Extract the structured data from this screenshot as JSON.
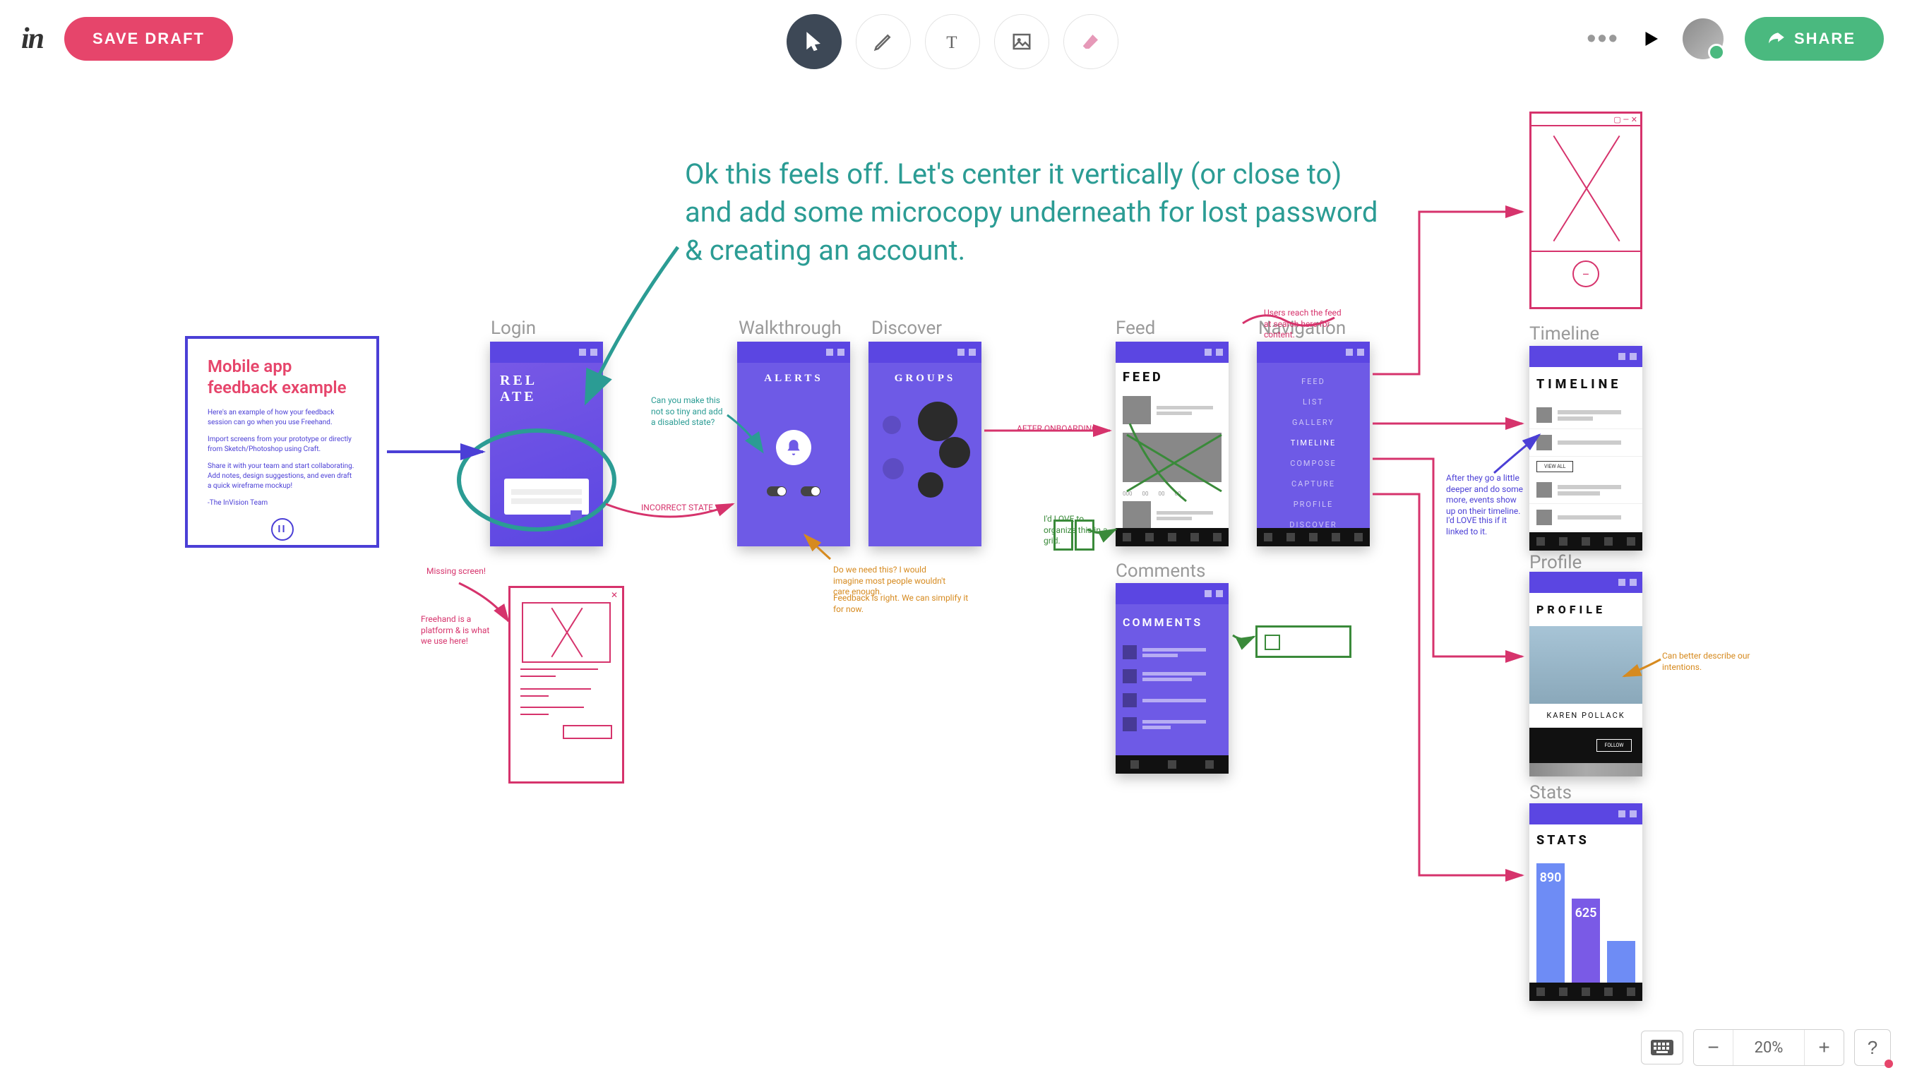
{
  "header": {
    "logo": "in",
    "save_draft": "SAVE DRAFT",
    "share": "SHARE",
    "zoom": "20%"
  },
  "annotation_main": "Ok this feels off. Let's center it vertically (or close to) and add some microcopy underneath for lost password & creating an account.",
  "labels": {
    "login": "Login",
    "walkthrough": "Walkthrough",
    "discover": "Discover",
    "feed": "Feed",
    "navigation": "Navigation",
    "timeline": "Timeline",
    "comments": "Comments",
    "profile": "Profile",
    "stats": "Stats"
  },
  "info_card": {
    "title": "Mobile app feedback example",
    "p1": "Here's an example of how your feedback session can go when you use Freehand.",
    "p2": "Import screens from your prototype or directly from Sketch/Photoshop using Craft.",
    "p3": "Share it with your team and start collaborating. Add notes, design suggestions, and even draft a quick wireframe mockup!",
    "sig": "-The InVision Team"
  },
  "notes": {
    "missing_screen": "Missing screen!",
    "freehand_note": "Freehand is a platform & is what we use here!",
    "incorrect_state": "INCORRECT STATE",
    "add_toggle": "Can you make this not so tiny and add a disabled state?",
    "too_much": "Do we need this? I would imagine most people wouldn't care enough.",
    "simplify": "Feedback is right. We can simplify it for now.",
    "after_onboarding": "AFTER ONBOARDING",
    "org_grid": "I'd LOVE to organize this in a grid.",
    "users_reach": "Users reach the feed at search here for content.",
    "timeline_note": "After they go a little deeper and do some more, events show up on their timeline.",
    "timeline_note2": "I'd LOVE this if it linked to it.",
    "profile_note": "Can better describe our intentions.",
    "profile_name": "KAREN POLLACK"
  },
  "screens": {
    "login_title": "REL\nATE",
    "alerts": "ALERTS",
    "groups": "GROUPS",
    "feed": "FEED",
    "timeline": "TIMELINE",
    "comments": "COMMENTS",
    "profile": "PROFILE",
    "stats": "STATS",
    "view_all": "VIEW ALL",
    "follow": "FOLLOW",
    "nav_items": [
      "FEED",
      "LIST",
      "GALLERY",
      "TIMELINE",
      "COMPOSE",
      "CAPTURE",
      "PROFILE",
      "DISCOVER"
    ],
    "stat_1": "890",
    "stat_2": "625"
  }
}
